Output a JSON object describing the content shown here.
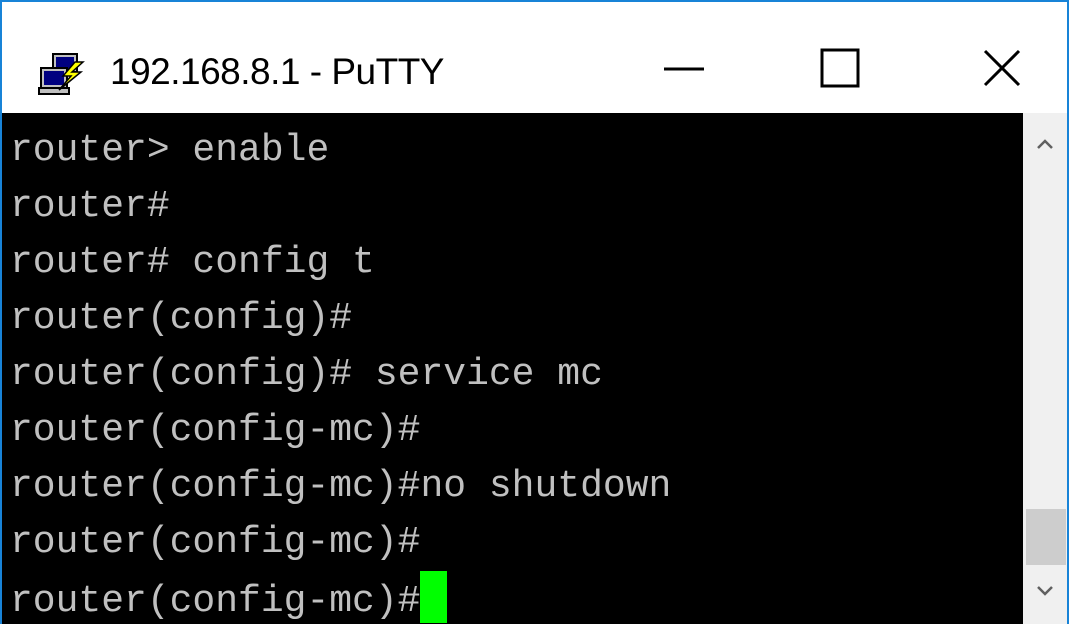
{
  "window": {
    "title": "192.168.8.1 - PuTTY",
    "app_icon": "putty-icon",
    "controls": {
      "minimize_icon": "minimize-icon",
      "maximize_icon": "maximize-icon",
      "close_icon": "close-icon"
    },
    "accent_color": "#1883d7"
  },
  "terminal": {
    "background": "#000000",
    "text_color": "#c0c0c0",
    "cursor_color": "#00ff00",
    "lines": [
      "router> enable",
      "router#",
      "router# config t",
      "router(config)#",
      "router(config)# service mc",
      "router(config-mc)#",
      "router(config-mc)#no shutdown",
      "router(config-mc)#",
      "router(config-mc)#"
    ]
  },
  "scrollbar": {
    "up_icon": "chevron-up-icon",
    "down_icon": "chevron-down-icon"
  }
}
